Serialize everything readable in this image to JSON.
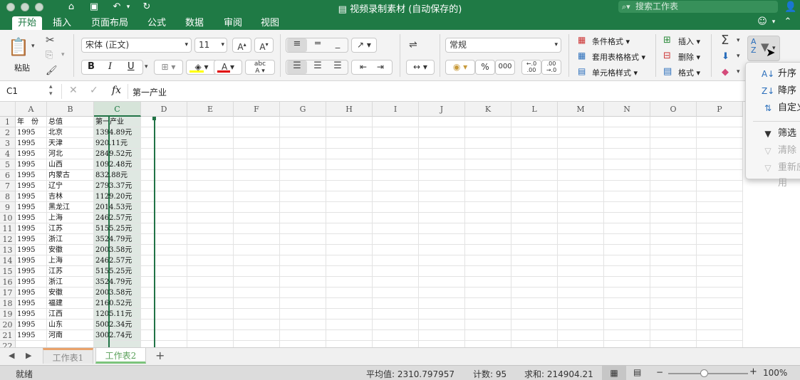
{
  "window": {
    "title": "视频录制素材 (自动保存的)"
  },
  "search": {
    "placeholder": "搜索工作表"
  },
  "tabs": [
    "开始",
    "插入",
    "页面布局",
    "公式",
    "数据",
    "审阅",
    "视图"
  ],
  "ribbon": {
    "paste_label": "粘贴",
    "font_name": "宋体 (正文)",
    "font_size": "11",
    "bold": "B",
    "italic": "I",
    "underline": "U",
    "number_format": "常规",
    "percent": "%",
    "thousands": "000",
    "dec_inc": "←.0\n.00",
    "cond_format": "条件格式",
    "table_format": "套用表格格式",
    "cell_style": "单元格样式",
    "insert": "插入",
    "delete": "删除",
    "format": "格式",
    "sigma": "Σ",
    "abc": "abc"
  },
  "formula": {
    "cell_ref": "C1",
    "fx": "fx",
    "content": "第一产业"
  },
  "columns": [
    "A",
    "B",
    "C",
    "D",
    "E",
    "F",
    "G",
    "H",
    "I",
    "J",
    "K",
    "L",
    "M",
    "N",
    "O",
    "P"
  ],
  "header_row": [
    "年　份",
    "总值",
    "第一产业"
  ],
  "rows": [
    [
      "1995",
      "北京",
      "1394.89元"
    ],
    [
      "1995",
      "天津",
      "920.11元"
    ],
    [
      "1995",
      "河北",
      "2849.52元"
    ],
    [
      "1995",
      "山西",
      "1092.48元"
    ],
    [
      "1995",
      "内蒙古",
      "832.88元"
    ],
    [
      "1995",
      "辽宁",
      "2793.37元"
    ],
    [
      "1995",
      "吉林",
      "1129.20元"
    ],
    [
      "1995",
      "黑龙江",
      "2014.53元"
    ],
    [
      "1995",
      "上海",
      "2462.57元"
    ],
    [
      "1995",
      "江苏",
      "5155.25元"
    ],
    [
      "1995",
      "浙江",
      "3524.79元"
    ],
    [
      "1995",
      "安徽",
      "2003.58元"
    ],
    [
      "1995",
      "上海",
      "2462.57元"
    ],
    [
      "1995",
      "江苏",
      "5155.25元"
    ],
    [
      "1995",
      "浙江",
      "3524.79元"
    ],
    [
      "1995",
      "安徽",
      "2003.58元"
    ],
    [
      "1995",
      "福建",
      "2160.52元"
    ],
    [
      "1995",
      "江西",
      "1205.11元"
    ],
    [
      "1995",
      "山东",
      "5002.34元"
    ],
    [
      "1995",
      "河南",
      "3002.74元"
    ]
  ],
  "sheets": [
    "工作表1",
    "工作表2"
  ],
  "active_sheet": 1,
  "status": {
    "ready": "就绪",
    "average": "平均值: 2310.797957",
    "count": "计数: 95",
    "sum": "求和: 214904.21",
    "zoom": "100%"
  },
  "sort_menu": {
    "items": [
      {
        "label": "升序",
        "disabled": false
      },
      {
        "label": "降序",
        "disabled": false
      },
      {
        "label": "自定义",
        "disabled": false
      },
      {
        "label": "筛选",
        "disabled": false
      },
      {
        "label": "清除",
        "disabled": true
      },
      {
        "label": "重新应用",
        "disabled": true
      }
    ]
  },
  "colors": {
    "brand": "#1f7a45",
    "fill_yellow": "#ffff00",
    "font_red": "#e00000"
  }
}
